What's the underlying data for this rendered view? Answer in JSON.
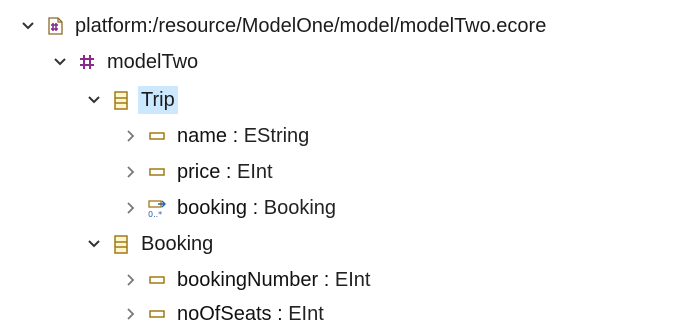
{
  "tree": {
    "resource": {
      "label": "platform:/resource/ModelOne/model/modelTwo.ecore",
      "icon": "ecore-resource-icon",
      "expanded": true
    },
    "package": {
      "label": "modelTwo",
      "icon": "epackage-icon",
      "expanded": true
    },
    "classes": [
      {
        "name": "Trip",
        "icon": "eclass-icon",
        "expanded": true,
        "selected": true,
        "features": [
          {
            "name": "name",
            "type": "EString",
            "kind": "attribute",
            "icon": "eattribute-icon"
          },
          {
            "name": "price",
            "type": "EInt",
            "kind": "attribute",
            "icon": "eattribute-icon"
          },
          {
            "name": "booking",
            "type": "Booking",
            "kind": "reference",
            "icon": "ereference-icon"
          }
        ]
      },
      {
        "name": "Booking",
        "icon": "eclass-icon",
        "expanded": true,
        "selected": false,
        "features": [
          {
            "name": "bookingNumber",
            "type": "EInt",
            "kind": "attribute",
            "icon": "eattribute-icon"
          },
          {
            "name": "noOfSeats",
            "type": "EInt",
            "kind": "attribute",
            "icon": "eattribute-icon"
          }
        ]
      }
    ],
    "separator": " : ",
    "colors": {
      "selection": "#cce8ff",
      "package_icon": "#8a2b8a",
      "class_icon": "#a07a14",
      "attribute_icon": "#a07a14",
      "twisty": "#333333"
    }
  }
}
